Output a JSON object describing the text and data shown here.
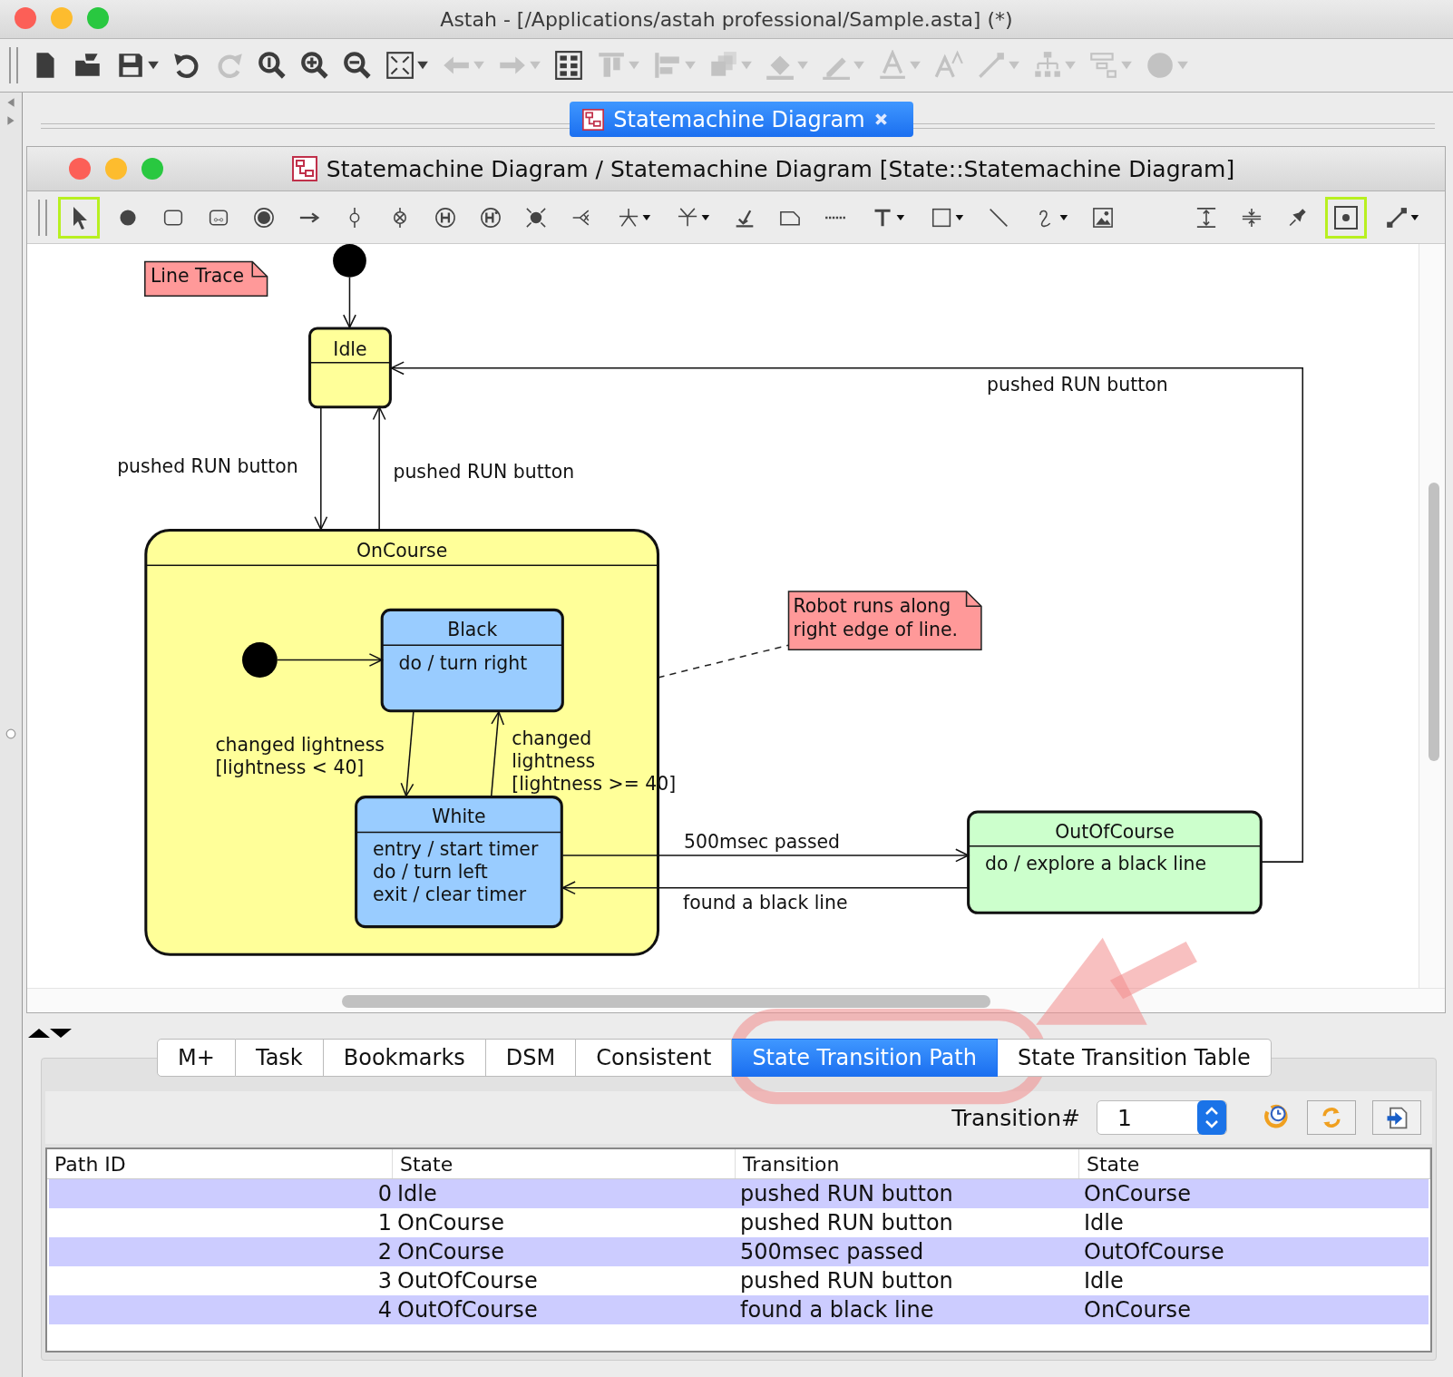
{
  "window": {
    "title": "Astah - [/Applications/astah professional/Sample.asta] (*)"
  },
  "toolbar": [
    {
      "kind": "new",
      "disabled": false,
      "menu": false
    },
    {
      "kind": "open",
      "disabled": false,
      "menu": false
    },
    {
      "kind": "save",
      "disabled": false,
      "menu": true
    },
    {
      "kind": "undo",
      "disabled": false,
      "menu": false
    },
    {
      "kind": "redo",
      "disabled": true,
      "menu": false
    },
    {
      "kind": "zoom",
      "disabled": false,
      "menu": false
    },
    {
      "kind": "zoom-in",
      "disabled": false,
      "menu": false
    },
    {
      "kind": "zoom-out",
      "disabled": false,
      "menu": false
    },
    {
      "kind": "fit",
      "disabled": false,
      "menu": true
    },
    {
      "kind": "back",
      "disabled": true,
      "menu": true
    },
    {
      "kind": "forward",
      "disabled": true,
      "menu": true
    },
    {
      "kind": "layout",
      "disabled": false,
      "menu": false
    },
    {
      "kind": "align-top",
      "disabled": true,
      "menu": true
    },
    {
      "kind": "align-left",
      "disabled": true,
      "menu": true
    },
    {
      "kind": "layer",
      "disabled": true,
      "menu": true
    },
    {
      "kind": "fill",
      "disabled": true,
      "menu": true
    },
    {
      "kind": "line-color",
      "disabled": true,
      "menu": true
    },
    {
      "kind": "font-color",
      "disabled": true,
      "menu": true
    },
    {
      "kind": "font-size",
      "disabled": true,
      "menu": false
    },
    {
      "kind": "line-style",
      "disabled": true,
      "menu": true
    },
    {
      "kind": "tree",
      "disabled": true,
      "menu": true
    },
    {
      "kind": "list",
      "disabled": true,
      "menu": true
    },
    {
      "kind": "circle",
      "disabled": true,
      "menu": true
    }
  ],
  "document_tab": {
    "label": "Statemachine Diagram",
    "selected": true
  },
  "diagram_window": {
    "title": "Statemachine Diagram / Statemachine Diagram [State::Statemachine Diagram]"
  },
  "palette": [
    {
      "kind": "pointer",
      "selected": true,
      "menu": false
    },
    {
      "kind": "initial",
      "selected": false,
      "menu": false
    },
    {
      "kind": "state",
      "selected": false,
      "menu": false
    },
    {
      "kind": "submachine",
      "selected": false,
      "menu": false
    },
    {
      "kind": "final",
      "selected": false,
      "menu": false
    },
    {
      "kind": "transition",
      "selected": false,
      "menu": false
    },
    {
      "kind": "junction",
      "selected": false,
      "menu": false
    },
    {
      "kind": "choice",
      "selected": false,
      "menu": false
    },
    {
      "kind": "history",
      "selected": false,
      "menu": false
    },
    {
      "kind": "deep-history",
      "selected": false,
      "menu": false
    },
    {
      "kind": "fork",
      "selected": false,
      "menu": false
    },
    {
      "kind": "cross",
      "selected": false,
      "menu": false
    },
    {
      "kind": "split",
      "selected": false,
      "menu": true
    },
    {
      "kind": "merge",
      "selected": false,
      "menu": true
    },
    {
      "kind": "signal",
      "selected": false,
      "menu": false
    },
    {
      "kind": "note",
      "selected": false,
      "menu": false
    },
    {
      "kind": "dotted",
      "selected": false,
      "menu": false
    },
    {
      "kind": "text",
      "selected": false,
      "menu": true
    },
    {
      "kind": "rectangle",
      "selected": false,
      "menu": true
    },
    {
      "kind": "line",
      "selected": false,
      "menu": false
    },
    {
      "kind": "curve",
      "selected": false,
      "menu": true
    },
    {
      "kind": "image",
      "selected": false,
      "menu": false
    },
    {
      "kind": "vspace",
      "selected": false,
      "menu": false
    },
    {
      "kind": "vshrink",
      "selected": false,
      "menu": false
    },
    {
      "kind": "pin",
      "selected": false,
      "menu": false
    },
    {
      "kind": "point",
      "selected": true,
      "menu": false
    },
    {
      "kind": "connector",
      "selected": false,
      "menu": true
    }
  ],
  "diagram": {
    "notes": [
      {
        "lines": [
          "Line Trace"
        ]
      },
      {
        "lines": [
          "Robot runs along",
          "right edge of line."
        ]
      }
    ],
    "states": [
      {
        "name": "Idle",
        "color": "#ffff99"
      },
      {
        "name": "OnCourse",
        "color": "#ffff99"
      },
      {
        "name": "Black",
        "color": "#99ccff",
        "activities": [
          "do / turn right"
        ]
      },
      {
        "name": "White",
        "color": "#99ccff",
        "activities": [
          "entry / start timer",
          "do / turn left",
          "exit / clear timer"
        ]
      },
      {
        "name": "OutOfCourse",
        "color": "#ccffcc",
        "activities": [
          "do / explore a black line"
        ]
      }
    ],
    "transitions": [
      {
        "lines": [
          "pushed RUN button"
        ]
      },
      {
        "lines": [
          "pushed RUN button"
        ]
      },
      {
        "lines": [
          "pushed RUN button"
        ]
      },
      {
        "lines": [
          "changed lightness",
          "[lightness < 40]"
        ]
      },
      {
        "lines": [
          "changed",
          "lightness",
          "[lightness >= 40]"
        ]
      },
      {
        "lines": [
          "500msec passed"
        ]
      },
      {
        "lines": [
          "found a black line"
        ]
      }
    ]
  },
  "panel_tabs": [
    {
      "label": "M+",
      "selected": false
    },
    {
      "label": "Task",
      "selected": false
    },
    {
      "label": "Bookmarks",
      "selected": false
    },
    {
      "label": "DSM",
      "selected": false
    },
    {
      "label": "Consistent",
      "selected": false
    },
    {
      "label": "State Transition Path",
      "selected": true
    },
    {
      "label": "State Transition Table",
      "selected": false
    }
  ],
  "transition_number": {
    "label": "Transition#",
    "value": "1"
  },
  "table": {
    "columns": [
      "Path ID",
      "State",
      "Transition",
      "State"
    ],
    "rows": [
      {
        "cells": [
          "0",
          "Idle",
          "pushed RUN button",
          "OnCourse"
        ],
        "selected": true
      },
      {
        "cells": [
          "1",
          "OnCourse",
          "pushed RUN button",
          "Idle"
        ],
        "selected": false
      },
      {
        "cells": [
          "2",
          "OnCourse",
          "500msec passed",
          "OutOfCourse"
        ],
        "selected": true
      },
      {
        "cells": [
          "3",
          "OutOfCourse",
          "pushed RUN button",
          "Idle"
        ],
        "selected": false
      },
      {
        "cells": [
          "4",
          "OutOfCourse",
          "found a black line",
          "OnCourse"
        ],
        "selected": true
      }
    ]
  }
}
